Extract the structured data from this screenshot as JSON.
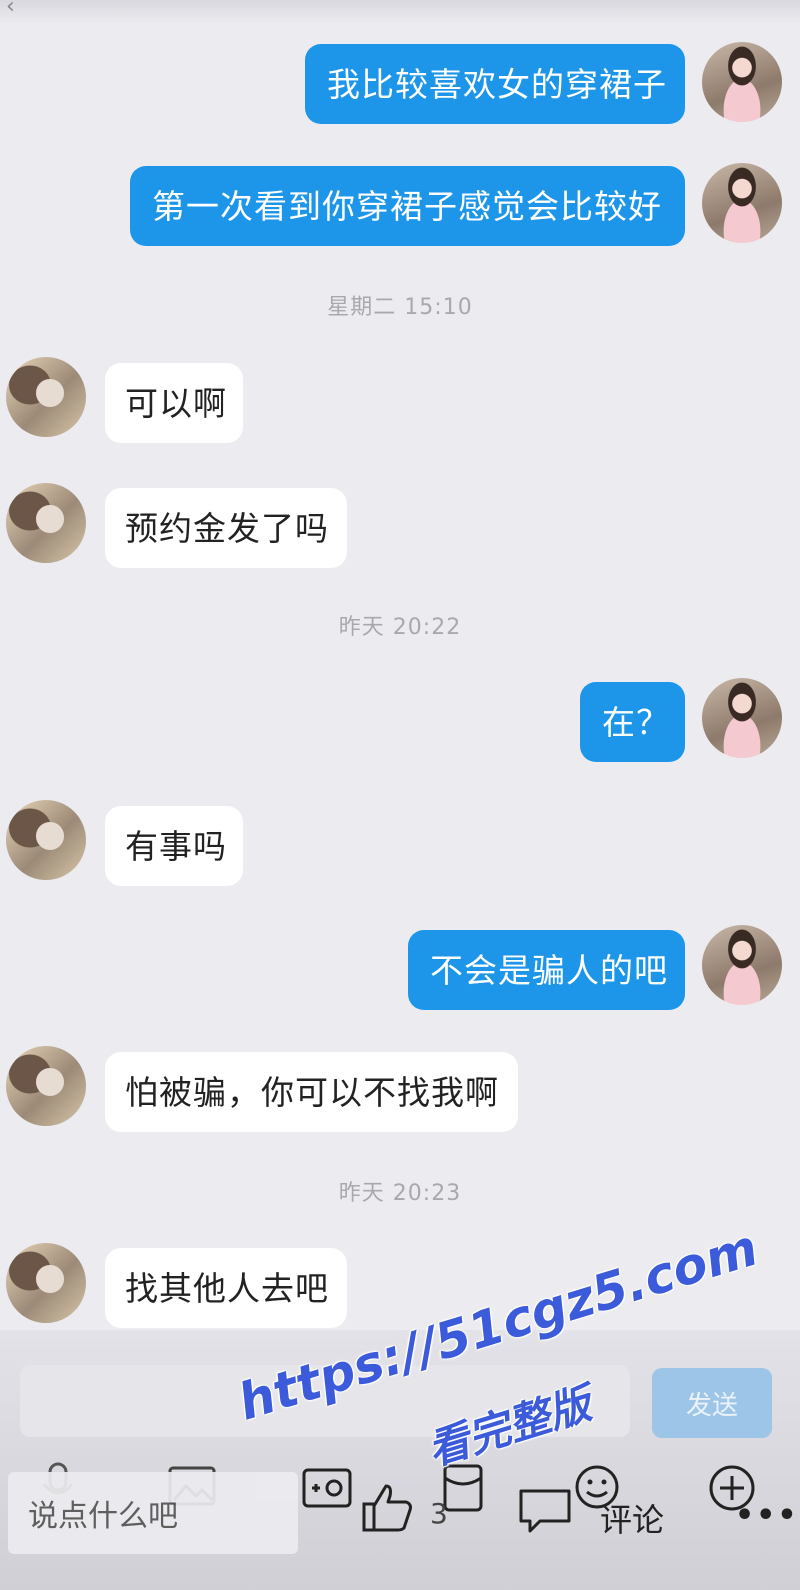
{
  "top_bar": {
    "back_icon": "back-arrow-icon"
  },
  "messages": [
    {
      "side": "out",
      "text": "我比较喜欢女的穿裙子"
    },
    {
      "side": "out",
      "text": "第一次看到你穿裙子感觉会比较好"
    },
    {
      "type": "timestamp",
      "text": "星期二 15:10"
    },
    {
      "side": "in",
      "text": "可以啊"
    },
    {
      "side": "in",
      "text": "预约金发了吗"
    },
    {
      "type": "timestamp",
      "text": "昨天 20:22"
    },
    {
      "side": "out",
      "text": "在？"
    },
    {
      "side": "in",
      "text": "有事吗"
    },
    {
      "side": "out",
      "text": "不会是骗人的吧"
    },
    {
      "side": "in",
      "text": "怕被骗，你可以不找我啊"
    },
    {
      "type": "timestamp",
      "text": "昨天 20:23"
    },
    {
      "side": "in",
      "text": "找其他人去吧"
    }
  ],
  "composer": {
    "input_value": "",
    "send_label": "发送"
  },
  "composer_icons": [
    "microphone-icon",
    "image-icon",
    "camera-icon",
    "red-packet-icon",
    "emoji-icon",
    "plus-circle-icon"
  ],
  "bottom_bar": {
    "say_placeholder": "说点什么吧",
    "like_count": "3",
    "comment_label": "评论",
    "more_label": "•••"
  },
  "watermark": {
    "url": "https://51cgz5.com",
    "text": "看完整版"
  },
  "colors": {
    "outgoing_bubble": "#1d96ea",
    "incoming_bubble": "#ffffff",
    "background": "#ebebf0",
    "watermark": "#3b5bdb"
  }
}
